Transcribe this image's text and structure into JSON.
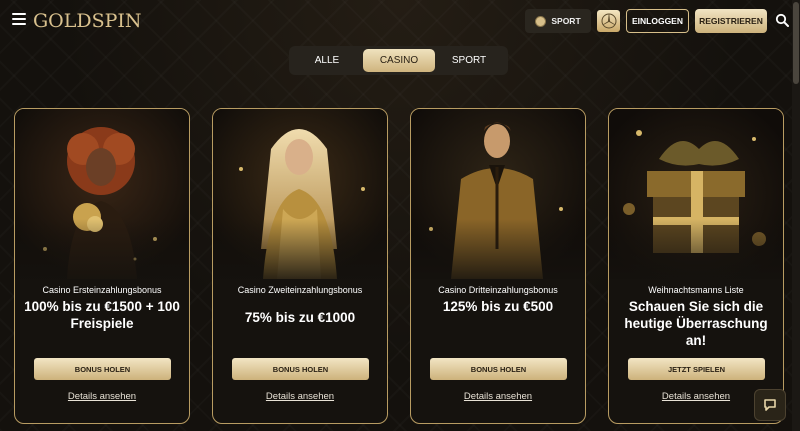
{
  "header": {
    "logo": "GOLDSPIN",
    "sport_label": "SPORT",
    "login_label": "EINLOGGEN",
    "register_label": "REGISTRIEREN"
  },
  "tabs": [
    {
      "label": "ALLE",
      "active": false
    },
    {
      "label": "CASINO",
      "active": true
    },
    {
      "label": "SPORT",
      "active": false
    }
  ],
  "cards": [
    {
      "subtitle": "Casino Ersteinzahlungsbonus",
      "headline": "100% bis zu €1500 + 100 Freispiele",
      "cta": "BONUS HOLEN",
      "details": "Details ansehen"
    },
    {
      "subtitle": "Casino Zweiteinzahlungsbonus",
      "headline": "75% bis zu €1000",
      "cta": "BONUS HOLEN",
      "details": "Details ansehen"
    },
    {
      "subtitle": "Casino Dritteinzahlungsbonus",
      "headline": "125% bis zu €500",
      "cta": "BONUS HOLEN",
      "details": "Details ansehen"
    },
    {
      "subtitle": "Weihnachtsmanns Liste",
      "headline": "Schauen Sie sich die heutige Überraschung an!",
      "cta": "JETZT SPIELEN",
      "details": "Details ansehen"
    }
  ],
  "colors": {
    "background": "#14110d",
    "gold": "#d7bf8a",
    "gold_button": "#cdb27b",
    "card_border": "#b89c62"
  },
  "icons": {
    "menu": "hamburger-menu-icon",
    "sport": "soccer-ball-icon",
    "partner": "mercedes-star-icon",
    "search": "search-icon",
    "chat": "chat-bubble-icon"
  }
}
